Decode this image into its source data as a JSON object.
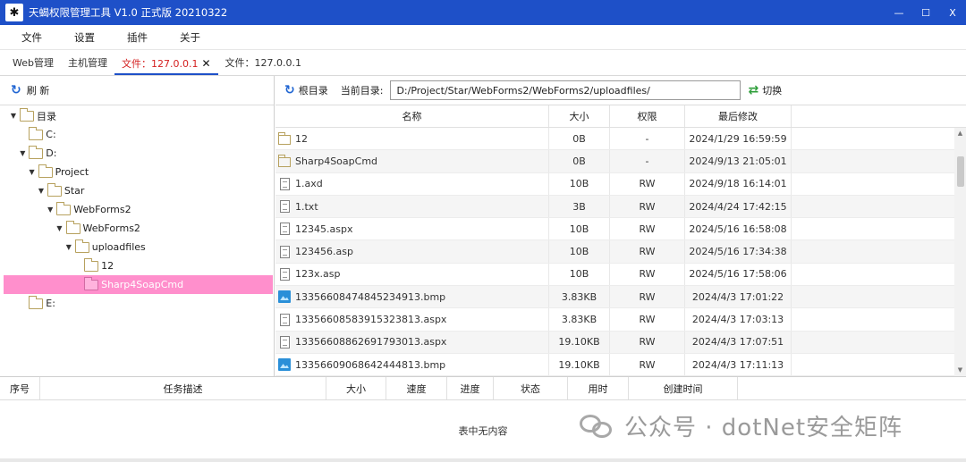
{
  "window": {
    "title": "天蝎权限管理工具 V1.0 正式版 20210322",
    "icon": "scorpion-icon",
    "minimize": "—",
    "maximize": "☐",
    "close": "X"
  },
  "menu": {
    "items": [
      "文件",
      "设置",
      "插件",
      "关于"
    ]
  },
  "tabs": [
    {
      "label": "Web管理",
      "active": false
    },
    {
      "label": "主机管理",
      "active": false
    },
    {
      "label": "文件：127.0.0.1",
      "active": true,
      "close": "✕"
    },
    {
      "label": "文件：127.0.0.1",
      "active": false
    }
  ],
  "left": {
    "refresh_label": "刷 新",
    "tree": [
      {
        "label": "目录",
        "level": 0,
        "expanded": true
      },
      {
        "label": "C:",
        "level": 1,
        "expanded": false
      },
      {
        "label": "D:",
        "level": 1,
        "expanded": true
      },
      {
        "label": "Project",
        "level": 2,
        "expanded": true
      },
      {
        "label": "Star",
        "level": 3,
        "expanded": true
      },
      {
        "label": "WebForms2",
        "level": 4,
        "expanded": true
      },
      {
        "label": "WebForms2",
        "level": 5,
        "expanded": true
      },
      {
        "label": "uploadfiles",
        "level": 6,
        "expanded": true
      },
      {
        "label": "12",
        "level": 7,
        "expanded": false
      },
      {
        "label": "Sharp4SoapCmd",
        "level": 7,
        "expanded": false,
        "selected": true
      },
      {
        "label": "E:",
        "level": 1,
        "expanded": false
      }
    ]
  },
  "right": {
    "root_label": "根目录",
    "current_dir_label": "当前目录:",
    "current_dir_value": "D:/Project/Star/WebForms2/WebForms2/uploadfiles/",
    "switch_label": "切换",
    "columns": {
      "name": "名称",
      "size": "大小",
      "perm": "权限",
      "modified": "最后修改"
    },
    "files": [
      {
        "type": "folder",
        "name": "12",
        "size": "0B",
        "perm": "-",
        "modified": "2024/1/29 16:59:59"
      },
      {
        "type": "folder",
        "name": "Sharp4SoapCmd",
        "size": "0B",
        "perm": "-",
        "modified": "2024/9/13 21:05:01"
      },
      {
        "type": "file",
        "name": "1.axd",
        "size": "10B",
        "perm": "RW",
        "modified": "2024/9/18 16:14:01"
      },
      {
        "type": "file",
        "name": "1.txt",
        "size": "3B",
        "perm": "RW",
        "modified": "2024/4/24 17:42:15"
      },
      {
        "type": "file",
        "name": "12345.aspx",
        "size": "10B",
        "perm": "RW",
        "modified": "2024/5/16 16:58:08"
      },
      {
        "type": "file",
        "name": "123456.asp",
        "size": "10B",
        "perm": "RW",
        "modified": "2024/5/16 17:34:38"
      },
      {
        "type": "file",
        "name": "123x.asp",
        "size": "10B",
        "perm": "RW",
        "modified": "2024/5/16 17:58:06"
      },
      {
        "type": "image",
        "name": "133566084748452349​13.bmp",
        "size": "3.83KB",
        "perm": "RW",
        "modified": "2024/4/3 17:01:22"
      },
      {
        "type": "file",
        "name": "133566085839153238​13.aspx",
        "size": "3.83KB",
        "perm": "RW",
        "modified": "2024/4/3 17:03:13"
      },
      {
        "type": "file",
        "name": "133566088626917930​13.aspx",
        "size": "19.10KB",
        "perm": "RW",
        "modified": "2024/4/3 17:07:51"
      },
      {
        "type": "image",
        "name": "13356609068642444813.bmp",
        "size": "19.10KB",
        "perm": "RW",
        "modified": "2024/4/3 17:11:13"
      }
    ]
  },
  "tasks": {
    "columns": [
      "序号",
      "任务描述",
      "大小",
      "速度",
      "进度",
      "状态",
      "用时",
      "创建时间"
    ],
    "empty": "表中无内容"
  },
  "watermark": {
    "text": "公众号 · dotNet安全矩阵"
  }
}
